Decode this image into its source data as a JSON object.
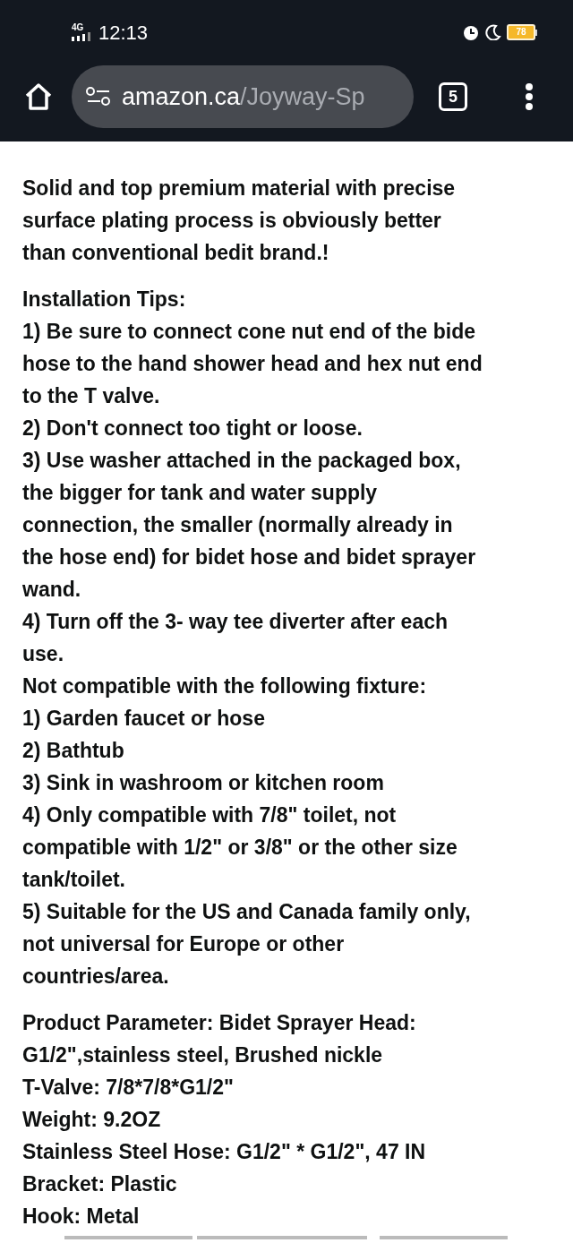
{
  "status_bar": {
    "network": "4G",
    "time": "12:13",
    "battery": "78"
  },
  "browser": {
    "url_domain": "amazon.ca",
    "url_path": "/Joyway-Sp",
    "tab_count": "5"
  },
  "paragraphs": [
    {
      "lines": [
        "Solid and top premium material with precise",
        "surface plating process is obviously better",
        "than conventional bedit brand.!"
      ]
    },
    {
      "lines": [
        "Installation Tips:",
        "1) Be sure to connect cone nut end of the bide",
        "hose to the hand shower head and hex nut end",
        "to the T valve.",
        "2) Don't connect too tight or loose.",
        "3) Use washer attached in the packaged box,",
        "the bigger for tank and water supply",
        "connection, the smaller (normally already in",
        "the hose end) for bidet hose and bidet sprayer",
        "wand.",
        "4) Turn off the 3- way tee diverter after each",
        "use.",
        "Not compatible with the following fixture:",
        "1) Garden faucet or hose",
        "2) Bathtub",
        "3) Sink in washroom or kitchen room",
        "4) Only compatible with 7/8\" toilet, not",
        "compatible with 1/2\" or 3/8\" or the other size",
        "tank/toilet.",
        "5) Suitable for the US and Canada family only,",
        "not universal for Europe or other",
        "countries/area."
      ]
    },
    {
      "lines": [
        "Product Parameter: Bidet Sprayer Head:",
        "G1/2\",stainless steel, Brushed nickle",
        "T-Valve: 7/8*7/8*G1/2\"",
        "Weight: 9.2OZ",
        "Stainless Steel Hose: G1/2\" * G1/2\", 47 IN",
        "Bracket: Plastic",
        "Hook: Metal"
      ]
    }
  ]
}
